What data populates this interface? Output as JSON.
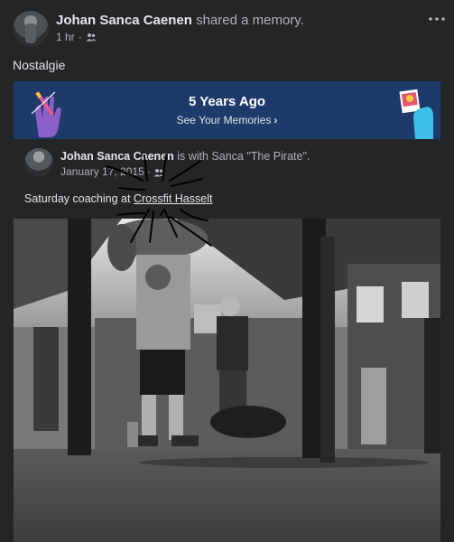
{
  "post": {
    "author": "Johan Sanca Caenen",
    "action": "shared a memory.",
    "time": "1 hr",
    "separator": "·",
    "privacy_icon": "friends-icon",
    "options_icon": "more-options-icon",
    "caption": "Nostalgie"
  },
  "memory_banner": {
    "title": "5 Years Ago",
    "link": "See Your Memories",
    "chevron": "›"
  },
  "shared_post": {
    "author": "Johan Sanca Caenen",
    "with_text": "is with Sanca \"The Pirate\".",
    "date": "January 17, 2015",
    "separator": "·",
    "privacy_icon": "friends-icon",
    "text_prefix": "Saturday coaching at ",
    "text_link": "Crossfit Hasselt"
  },
  "colors": {
    "background": "#242526",
    "banner": "#1d3a6b",
    "primary_text": "#e4e6eb",
    "secondary_text": "#b0b3b8"
  }
}
